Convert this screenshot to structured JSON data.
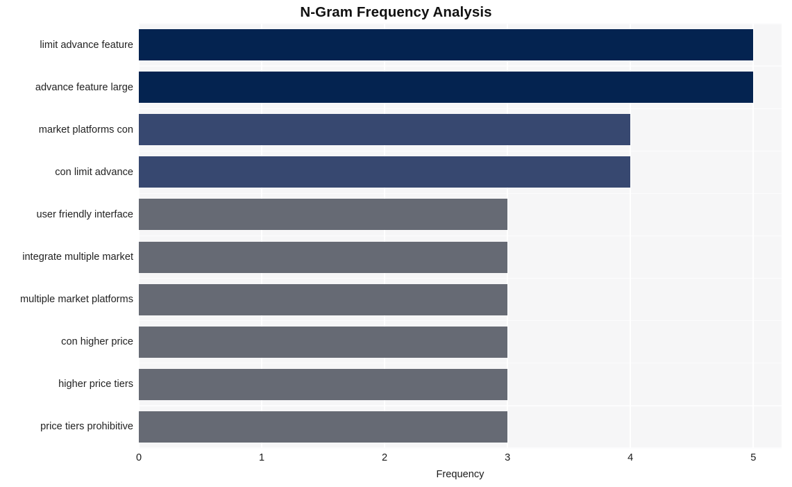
{
  "chart_data": {
    "type": "bar",
    "orientation": "horizontal",
    "title": "N-Gram Frequency Analysis",
    "xlabel": "Frequency",
    "ylabel": "",
    "categories": [
      "limit advance feature",
      "advance feature large",
      "market platforms con",
      "con limit advance",
      "user friendly interface",
      "integrate multiple market",
      "multiple market platforms",
      "con higher price",
      "higher price tiers",
      "price tiers prohibitive"
    ],
    "values": [
      5,
      5,
      4,
      4,
      3,
      3,
      3,
      3,
      3,
      3
    ],
    "bar_colors": [
      "#042350",
      "#042350",
      "#374870",
      "#374870",
      "#666a74",
      "#666a74",
      "#666a74",
      "#666a74",
      "#666a74",
      "#666a74"
    ],
    "xlim": [
      0,
      5.23
    ],
    "xticks": [
      0,
      1,
      2,
      3,
      4,
      5
    ],
    "xtick_labels": [
      "0",
      "1",
      "2",
      "3",
      "4",
      "5"
    ],
    "grid": true,
    "grid_color": "#ffffff",
    "plot_background": "#f6f6f7",
    "figure_background": "#ffffff",
    "legend": null
  }
}
